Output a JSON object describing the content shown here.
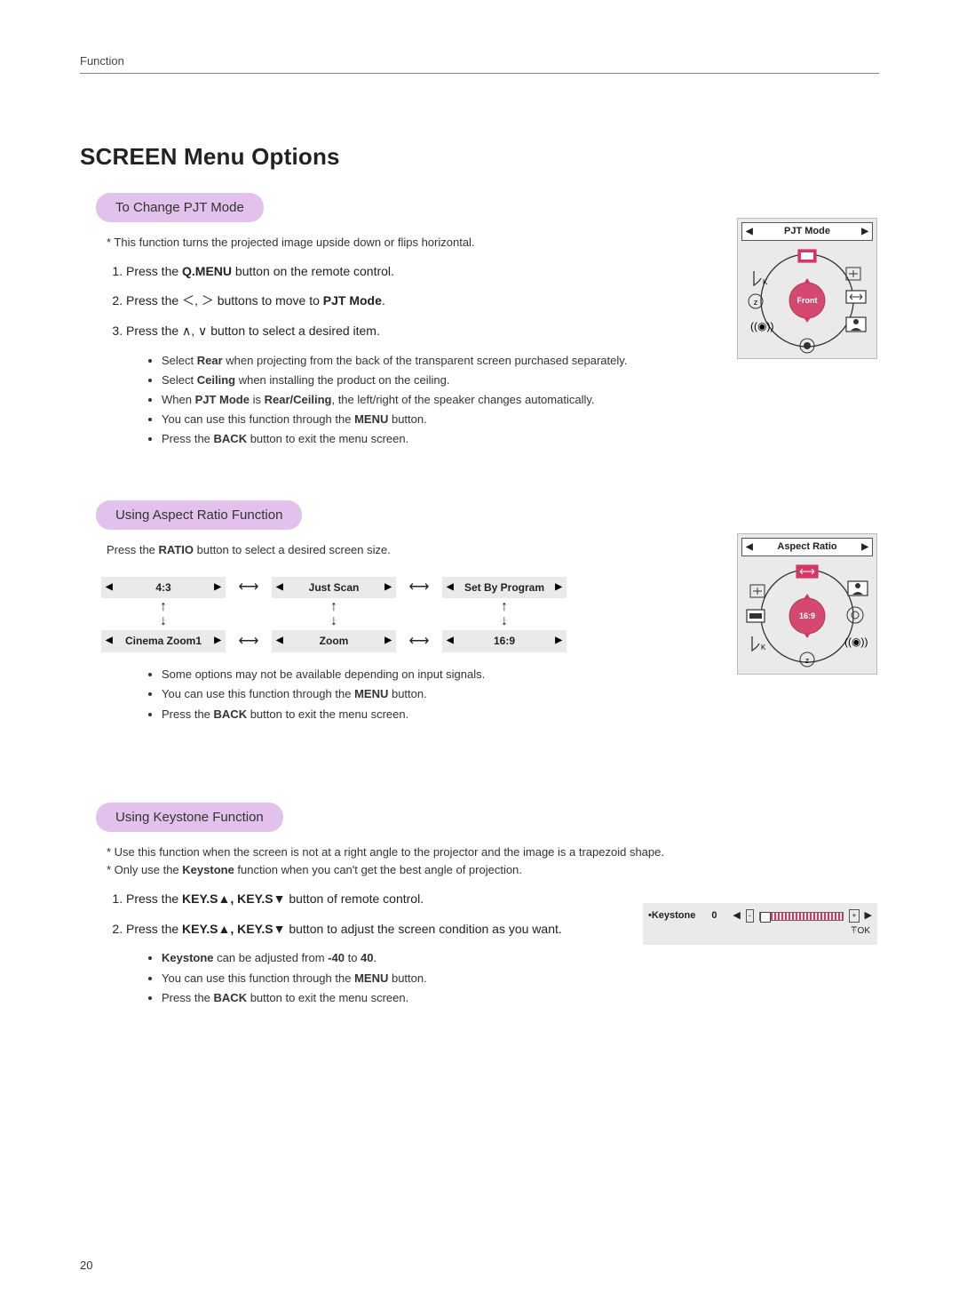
{
  "header": {
    "section": "Function",
    "page_number": "20"
  },
  "title": "SCREEN Menu Options",
  "pjt": {
    "heading": "To Change PJT Mode",
    "note": "* This function turns the projected image upside down or flips horizontal.",
    "steps": {
      "s1_a": "Press the ",
      "s1_b": "Q.MENU",
      "s1_c": " button on the remote control.",
      "s2_a": "Press the ",
      "s2_b": "＜, ＞",
      "s2_c": " buttons to move to ",
      "s2_d": "PJT Mode",
      "s2_e": ".",
      "s3_a": "Press the ",
      "s3_b": "∧, ∨",
      "s3_c": " button to select a desired item."
    },
    "bullets": {
      "b1a": "Select ",
      "b1b": "Rear",
      "b1c": " when projecting from the back of the transparent screen purchased separately.",
      "b2a": "Select ",
      "b2b": "Ceiling",
      "b2c": " when installing the product on the ceiling.",
      "b3a": "When ",
      "b3b": "PJT Mode",
      "b3c": " is ",
      "b3d": "Rear/Ceiling",
      "b3e": ", the left/right of the speaker changes automatically.",
      "b4a": "You can use this function through the ",
      "b4b": "MENU",
      "b4c": " button.",
      "b5a": "Press the ",
      "b5b": "BACK",
      "b5c": " button to exit the menu screen."
    },
    "diagram": {
      "title": "PJT Mode",
      "center_label": "Front"
    }
  },
  "ratio": {
    "heading": "Using Aspect Ratio Function",
    "intro_a": "Press the ",
    "intro_b": "RATIO",
    "intro_c": "  button to select a desired screen size.",
    "options": {
      "a1": "4:3",
      "a2": "Just Scan",
      "a3": "Set By Program",
      "b1": "Cinema Zoom1",
      "b2": "Zoom",
      "b3": "16:9"
    },
    "bullets": {
      "b1": "Some options may not be available depending on input signals.",
      "b2a": "You can use this function through the ",
      "b2b": "MENU",
      "b2c": " button.",
      "b3a": "Press the ",
      "b3b": "BACK",
      "b3c": " button to exit the menu screen."
    },
    "diagram": {
      "title": "Aspect Ratio",
      "center_label": "16:9"
    }
  },
  "keystone": {
    "heading": "Using Keystone Function",
    "note1": "* Use this function when the screen is not at a right angle to the projector and the image is a trapezoid shape.",
    "note2_a": "* Only use the ",
    "note2_b": "Keystone",
    "note2_c": " function when you can't get the best angle of projection.",
    "steps": {
      "s1_a": "Press the ",
      "s1_b": "KEY.S▲, KEY.S▼",
      "s1_c": " button of remote control.",
      "s2_a": "Press the ",
      "s2_b": "KEY.S▲, KEY.S▼",
      "s2_c": " button to adjust the screen condition as you want."
    },
    "bullets": {
      "b1a": "Keystone",
      "b1b": " can be adjusted from ",
      "b1c": "-40",
      "b1d": " to ",
      "b1e": "40",
      "b1f": ".",
      "b2a": "You can use this function through the ",
      "b2b": "MENU",
      "b2c": " button.",
      "b3a": "Press the ",
      "b3b": "BACK",
      "b3c": " button to exit the menu screen."
    },
    "osd": {
      "label": "•Keystone",
      "value": "0",
      "ok": "ꔉOK",
      "min": "-",
      "max": "+"
    }
  },
  "chart_data": {
    "type": "table",
    "title": "Aspect ratio cycle (left-right navigation)",
    "items": [
      "4:3",
      "Just Scan",
      "Set By Program",
      "16:9",
      "Zoom",
      "Cinema Zoom1"
    ]
  }
}
